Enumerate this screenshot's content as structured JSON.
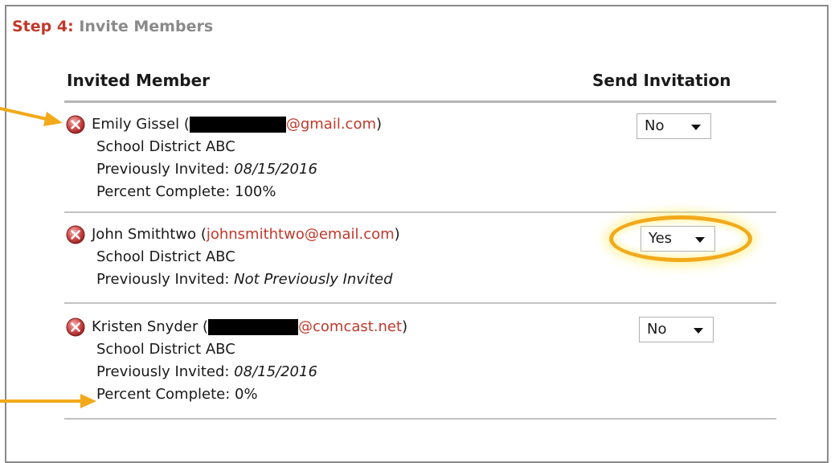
{
  "step": {
    "number_label": "Step 4:",
    "title": "Invite Members"
  },
  "table": {
    "col_member": "Invited Member",
    "col_send": "Send Invitation"
  },
  "members": [
    {
      "name": "Emily Gissel",
      "open_paren": "(",
      "email_visible": "@gmail.com",
      "close_paren": ")",
      "organization": "School District ABC",
      "previously_invited_label": "Previously Invited:",
      "previously_invited_value": "08/15/2016",
      "percent_label": "Percent Complete:",
      "percent_value": "100%",
      "send_invitation": "No"
    },
    {
      "name": "John Smithtwo",
      "open_paren": "(",
      "email_visible": "johnsmithtwo@email.com",
      "close_paren": ")",
      "organization": "School District ABC",
      "previously_invited_label": "Previously Invited:",
      "previously_invited_value": "Not Previously Invited",
      "send_invitation": "Yes"
    },
    {
      "name": "Kristen Snyder",
      "open_paren": "(",
      "email_visible": "@comcast.net",
      "close_paren": ")",
      "organization": "School District ABC",
      "previously_invited_label": "Previously Invited:",
      "previously_invited_value": "08/15/2016",
      "percent_label": "Percent Complete:",
      "percent_value": "0%",
      "send_invitation": "No"
    }
  ],
  "icons": {
    "remove": "remove-x-icon",
    "annotation": "arrow-right-icon",
    "highlight": "highlight-circle"
  },
  "colors": {
    "accent_red": "#c0392b",
    "heading_gray": "#8a8a8a",
    "annotation_orange": "#f2a91a",
    "annotation_glow": "#ffec6e"
  }
}
